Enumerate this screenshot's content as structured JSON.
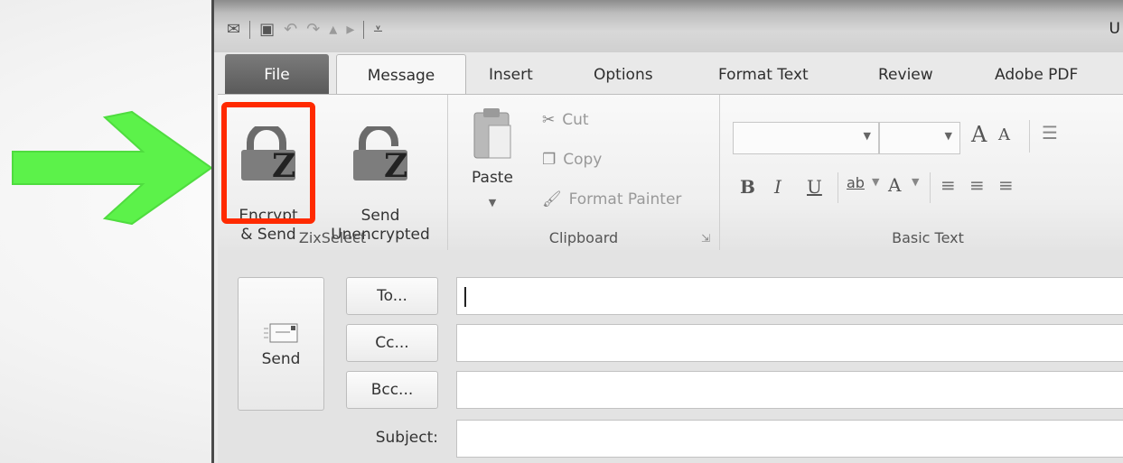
{
  "quick_access": {
    "icons": [
      "outlook-icon",
      "save-icon",
      "undo-icon",
      "redo-icon",
      "up-arrow-icon",
      "down-arrow-icon",
      "customize-icon"
    ]
  },
  "window": {
    "title_fragment": "U"
  },
  "tabs": [
    {
      "label": "File"
    },
    {
      "label": "Message"
    },
    {
      "label": "Insert"
    },
    {
      "label": "Options"
    },
    {
      "label": "Format Text"
    },
    {
      "label": "Review"
    },
    {
      "label": "Adobe PDF"
    }
  ],
  "ribbon": {
    "zixselect": {
      "label": "ZixSelect",
      "encrypt_send": "Encrypt\n& Send",
      "send_unencrypted": "Send\nUnencrypted"
    },
    "clipboard": {
      "label": "Clipboard",
      "paste": "Paste",
      "cut": "Cut",
      "copy": "Copy",
      "format_painter": "Format Painter"
    },
    "basic_text": {
      "label": "Basic Text",
      "font_value": "",
      "size_value": "",
      "grow": "A",
      "shrink": "A",
      "bold": "B",
      "italic": "I",
      "underline": "U",
      "highlight": "ab",
      "font_color": "A"
    }
  },
  "compose": {
    "send": "Send",
    "to": "To...",
    "cc": "Cc...",
    "bcc": "Bcc...",
    "subject": "Subject:",
    "to_value": "",
    "cc_value": "",
    "bcc_value": "",
    "subject_value": ""
  },
  "colors": {
    "highlight_box": "#ff2a00",
    "arrow": "#5cf24a"
  }
}
